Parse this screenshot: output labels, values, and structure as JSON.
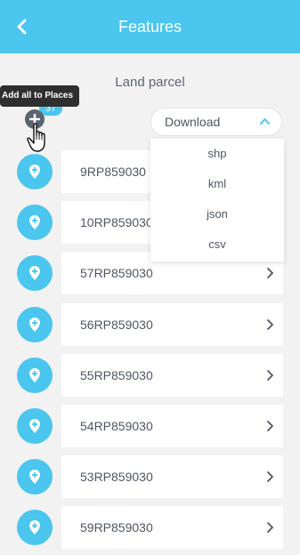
{
  "header": {
    "title": "Features",
    "background_color": "#4ac6ef",
    "back_icon": "chevron-left-icon"
  },
  "subtitle": "Land parcel",
  "add_all": {
    "icon": "plus-circle-icon",
    "tooltip": "Add all to Places",
    "count": "37"
  },
  "download": {
    "label": "Download",
    "icon": "chevron-up-icon",
    "options": [
      "shp",
      "kml",
      "json",
      "csv"
    ]
  },
  "features": [
    {
      "label": "9RP859030"
    },
    {
      "label": "10RP859030"
    },
    {
      "label": "57RP859030"
    },
    {
      "label": "56RP859030"
    },
    {
      "label": "55RP859030"
    },
    {
      "label": "54RP859030"
    },
    {
      "label": "53RP859030"
    },
    {
      "label": "59RP859030"
    }
  ],
  "colors": {
    "accent": "#4ac6ef",
    "background": "#f2f2f2",
    "text": "#4f5661"
  }
}
